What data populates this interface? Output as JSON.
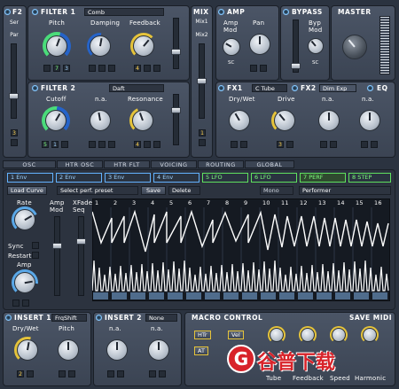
{
  "f2": {
    "title": "F2",
    "sub": [
      "Ser",
      "Par"
    ],
    "box": "3"
  },
  "filter1": {
    "title": "FILTER 1",
    "type": "Comb",
    "knobs": [
      {
        "label": "Pitch",
        "mods": [
          "7",
          "3"
        ]
      },
      {
        "label": "Damping",
        "mods": [
          "",
          ""
        ]
      },
      {
        "label": "Feedback",
        "mods": [
          "4",
          ""
        ]
      }
    ]
  },
  "filter2": {
    "title": "FILTER 2",
    "type": "Daft",
    "knobs": [
      {
        "label": "Cutoff",
        "mods": [
          "5",
          "1"
        ]
      },
      {
        "label": "n.a.",
        "mods": [
          "",
          ""
        ]
      },
      {
        "label": "Resonance",
        "mods": [
          "4",
          ""
        ]
      }
    ]
  },
  "mix": {
    "title": "MIX",
    "sub": [
      "Mix1",
      "Mix2"
    ],
    "box": "1"
  },
  "amp": {
    "title": "AMP",
    "modlabel": "Amp Mod",
    "pan": "Pan",
    "sc": "SC"
  },
  "bypass": {
    "title": "BYPASS",
    "modlabel": "Byp Mod",
    "sc": "SC"
  },
  "master": {
    "title": "MASTER"
  },
  "fx1": {
    "title": "FX1",
    "type": "C Tube",
    "tabs": [
      "FX2",
      "Dim Exp",
      "EQ"
    ],
    "knobs": [
      "Dry/Wet",
      "Drive",
      "n.a.",
      "n.a."
    ],
    "mods": [
      "",
      "3",
      "",
      ""
    ]
  },
  "sc_label": "SC",
  "section_tabs": [
    "OSC",
    "HTR OSC",
    "HTR FLT",
    "VOICING",
    "ROUTING",
    "GLOBAL"
  ],
  "seq_tabs": [
    {
      "label": "1 Env",
      "active": false
    },
    {
      "label": "2 Env",
      "active": false
    },
    {
      "label": "3 Env",
      "active": false
    },
    {
      "label": "4 Env",
      "active": false
    },
    {
      "label": "5 LFO",
      "active": true
    },
    {
      "label": "6 LFO",
      "active": true
    },
    {
      "label": "7 PERF",
      "active": true
    },
    {
      "label": "8 STEP",
      "active": true
    }
  ],
  "perf": {
    "load_curve": "Load Curve",
    "preset": "Select perf. preset",
    "save": "Save",
    "delete": "Delete",
    "mono": "Mono",
    "performer": "Performer",
    "rate": "Rate",
    "sync": "Sync",
    "restart": "Restart",
    "amp": "Amp",
    "ampmod": "Amp Mod",
    "xfade": "XFade Seq",
    "steps": [
      "1",
      "2",
      "3",
      "4",
      "5",
      "6",
      "7",
      "8",
      "9",
      "10",
      "11",
      "12",
      "13",
      "14",
      "15",
      "16"
    ]
  },
  "insert1": {
    "title": "INSERT 1",
    "type": "FrqShift",
    "knobs": [
      "Dry/Wet",
      "Pitch"
    ],
    "mods": [
      "2",
      ""
    ]
  },
  "insert2": {
    "title": "INSERT 2",
    "type": "None",
    "knobs": [
      "n.a.",
      "n.a."
    ],
    "mods": [
      "",
      ""
    ]
  },
  "macro": {
    "title": "MACRO CONTROL",
    "save": "SAVE MIDI",
    "buttons": [
      "HTr",
      "Vel",
      "AT"
    ],
    "knobs": [
      "Tube",
      "Feedback",
      "Speed",
      "Harmonic"
    ]
  },
  "watermark": "谷普下载"
}
